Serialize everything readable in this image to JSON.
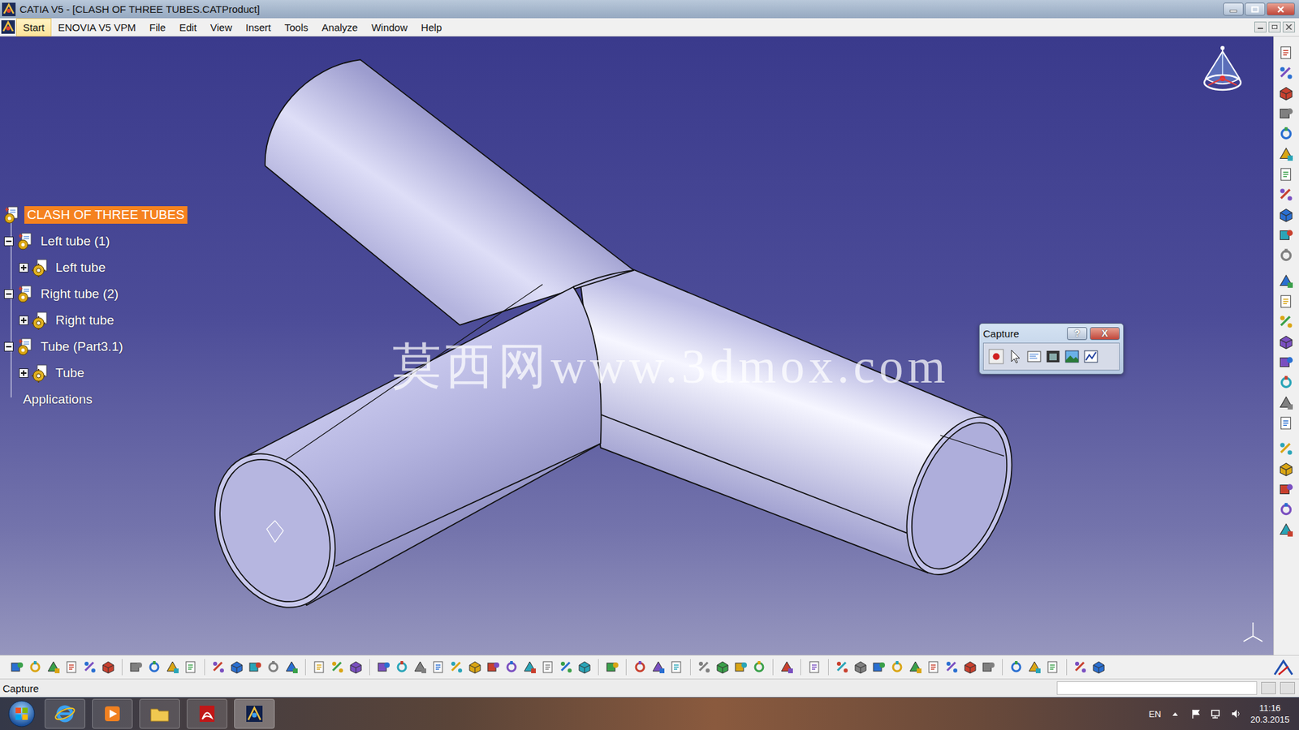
{
  "window": {
    "title": "CATIA V5 - [CLASH OF THREE TUBES.CATProduct]"
  },
  "menu": [
    {
      "label": "Start",
      "selected": true
    },
    {
      "label": "ENOVIA V5 VPM",
      "selected": false
    },
    {
      "label": "File",
      "selected": false
    },
    {
      "label": "Edit",
      "selected": false
    },
    {
      "label": "View",
      "selected": false
    },
    {
      "label": "Insert",
      "selected": false
    },
    {
      "label": "Tools",
      "selected": false
    },
    {
      "label": "Analyze",
      "selected": false
    },
    {
      "label": "Window",
      "selected": false
    },
    {
      "label": "Help",
      "selected": false
    }
  ],
  "tree": {
    "items": [
      {
        "label": "CLASH OF THREE TUBES",
        "kind": "root",
        "selected": true
      },
      {
        "label": "Left tube (1)",
        "kind": "product",
        "selected": false,
        "expanded": true
      },
      {
        "label": "Left tube",
        "kind": "part",
        "selected": false,
        "expanded": false
      },
      {
        "label": "Right tube (2)",
        "kind": "product",
        "selected": false,
        "expanded": true
      },
      {
        "label": "Right tube",
        "kind": "part",
        "selected": false,
        "expanded": false
      },
      {
        "label": "Tube (Part3.1)",
        "kind": "product",
        "selected": false,
        "expanded": true
      },
      {
        "label": "Tube",
        "kind": "part",
        "selected": false,
        "expanded": false
      },
      {
        "label": "Applications",
        "kind": "applications",
        "selected": false
      }
    ]
  },
  "watermark": {
    "text": "莫西网www.3dmox.com"
  },
  "capture": {
    "title": "Capture",
    "help": "?",
    "close": "X"
  },
  "status_bar": {
    "text": "Capture"
  },
  "taskbar": {
    "language": "EN",
    "time": "11:16",
    "date": "20.3.2015"
  }
}
